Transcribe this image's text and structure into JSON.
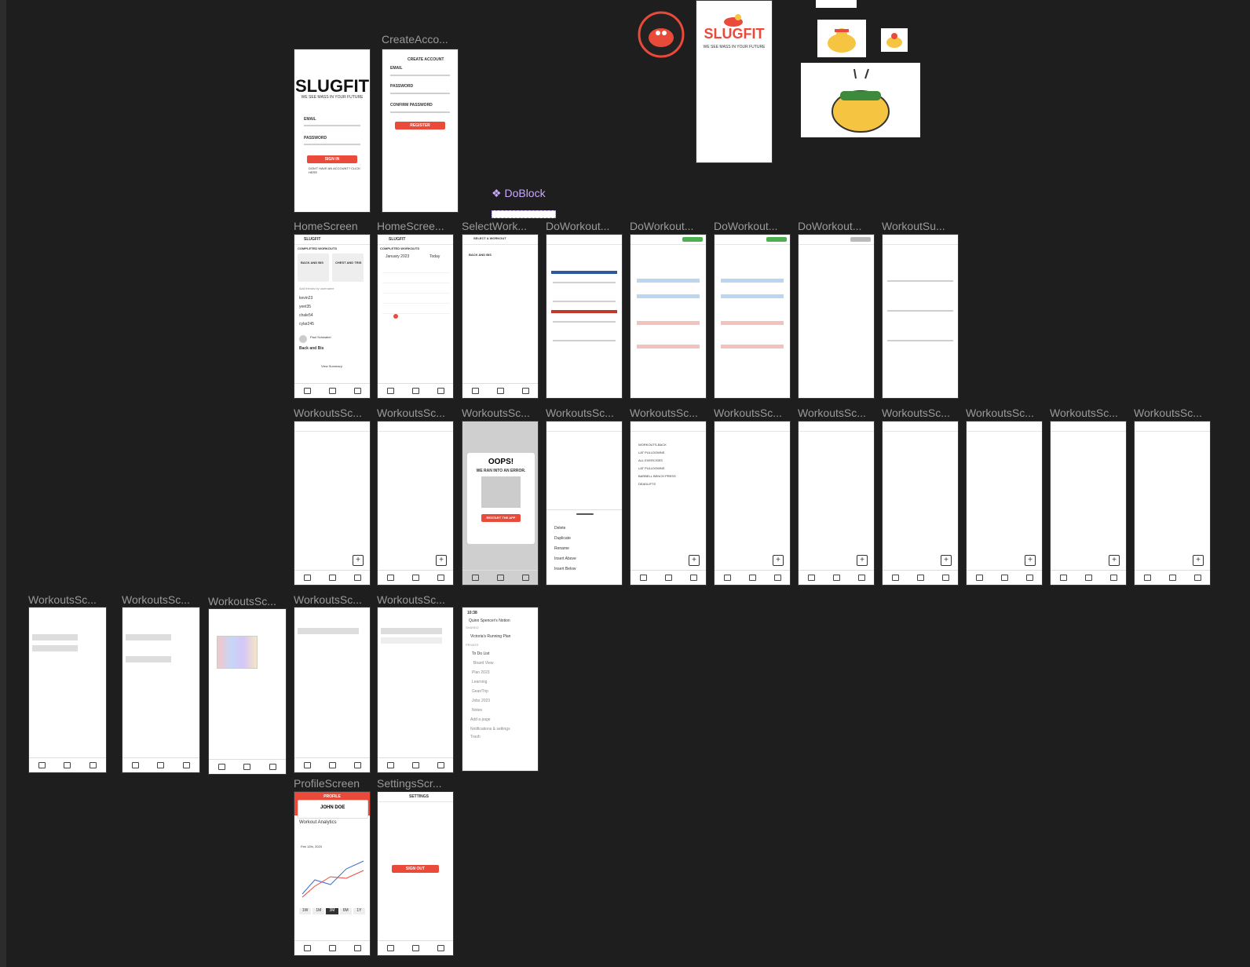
{
  "canvas": {
    "labels": {
      "create_account": "CreateAcco...",
      "doblock": "DoBlock",
      "home1": "HomeScreen",
      "home2": "HomeScree...",
      "select_workout": "SelectWork...",
      "doworkout": "DoWorkout...",
      "workout_summary": "WorkoutSu...",
      "workouts": "WorkoutsSc...",
      "profile": "ProfileScreen",
      "settings": "SettingsScr..."
    }
  },
  "brand": {
    "name": "SLUGFIT",
    "tagline": "WE SEE MASS IN YOUR FUTURE",
    "accent": "#e94a3a",
    "badge_text": "WE SEE MASS IN YOUR FUTURE"
  },
  "login": {
    "email_label": "EMAIL",
    "password_label": "PASSWORD",
    "signin": "SIGN IN",
    "no_account": "DON'T HAVE AN ACCOUNT? CLICK HERE"
  },
  "create_account": {
    "title": "CREATE ACCOUNT",
    "email": "EMAIL",
    "password": "PASSWORD",
    "confirm": "CONFIRM PASSWORD",
    "register": "REGISTER"
  },
  "home": {
    "title": "SLUGFIT",
    "completed": "COMPLETED WORKOUTS",
    "card1_title": "BACK AND BIS",
    "card2_title": "CHEST AND TRIS",
    "search_placeholder": "Add friends by username",
    "friends": [
      "kevin23",
      "yeet35",
      "chale54",
      "cylar245"
    ],
    "post_name": "Paul Schwabel",
    "post_title": "Back and Bis",
    "view_summary": "View Summary"
  },
  "calendar": {
    "title": "SLUGFIT",
    "completed": "COMPLETED WORKOUTS",
    "month": "January 2023",
    "today": "Today"
  },
  "select_workout": {
    "header": "SELECT A WORKOUT",
    "item": "BACK AND BIS"
  },
  "error_screen": {
    "oops": "OOPS!",
    "message": "WE RAN INTO AN ERROR.",
    "restart": "RESTART THE APP"
  },
  "context_menu": [
    "Delete",
    "Duplicate",
    "Rename",
    "Insert Above",
    "Insert Below"
  ],
  "workouts_list": [
    "WORKOUTS-BACK",
    "LAT PULLDOWNS",
    "ALL EXERCISES",
    "LAT PULLDOWNS",
    "BARBELL BENCH PRESS",
    "DEADLIFTS"
  ],
  "notion": {
    "time": "10:38",
    "workspace": "Quinn Spencer's Notion",
    "shared": "SHARED",
    "shared_item": "Victoria's Running Plan",
    "private": "PRIVATE",
    "items": [
      "To Do List",
      "Board View",
      "Plan 2023",
      "Learning",
      "Gear/Trip",
      "Jobs 2023",
      "Notes"
    ],
    "add_page": "Add a page",
    "notifications": "Notifications & settings",
    "trash": "Trash"
  },
  "profile": {
    "header": "PROFILE",
    "name": "JOHN DOE",
    "analytics": "Workout Analytics",
    "date": "Feb 12th, 2023",
    "ranges": [
      "1W",
      "1M",
      "3M",
      "6M",
      "1Y"
    ]
  },
  "settings": {
    "title": "SETTINGS",
    "signout": "SIGN OUT"
  }
}
